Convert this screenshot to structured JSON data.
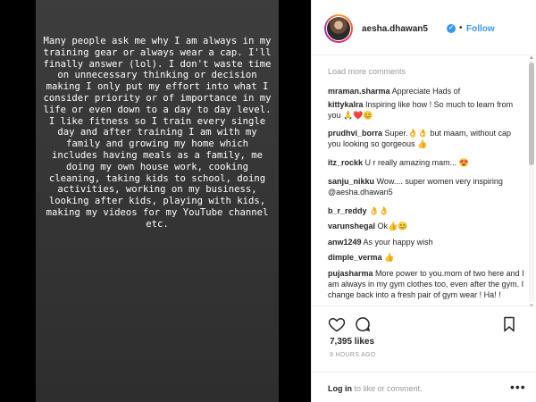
{
  "story": {
    "text": "Many people ask me why I am always in my training gear or always wear a cap.  I'll finally answer (lol).  I don't waste time on unnecessary thinking or decision making I only put my effort into what I consider priority or of importance in my life or even down to a day to day level.  I like fitness so I train every single day and after training I am with my family and growing my home which includes having meals as a family, me doing my own house work, cooking cleaning, taking kids to school, doing activities, working on my business, looking after kids, playing with kids, making my videos for my YouTube channel etc."
  },
  "header": {
    "username": "aesha.dhawan5",
    "verified_mark": "✓",
    "separator": "•",
    "follow_label": "Follow"
  },
  "comments": {
    "load_more": "Load more comments",
    "items": [
      {
        "user": "mraman.sharma",
        "text": "Appreciate Hads of"
      },
      {
        "user": "kittykalra",
        "text": "Inspiring like how ! So much to learn from you 🙏❤️😊"
      },
      {
        "user": "prudhvi_borra",
        "text": "Super.👌👌 but maam, without cap you looking so gorgeous 👍"
      },
      {
        "user": "itz_rockk",
        "text": "U r really amazing mam... 😍"
      },
      {
        "user": "sanju_nikku",
        "text": "Wow.... super women very inspiring @aesha.dhawan5"
      },
      {
        "user": "b_r_reddy",
        "text": "👌👌"
      },
      {
        "user": "varunshegal",
        "text": "Ok👍😊"
      },
      {
        "user": "anw1249",
        "text": "As your happy wish"
      },
      {
        "user": "dimple_verma",
        "text": "👍"
      },
      {
        "user": "pujasharma",
        "text": "More power to you.mom of two here and I am always in my gym clothes too, even after the gym. I change back into a fresh pair of gym wear ! Ha! !"
      }
    ]
  },
  "stats": {
    "likes": "7,395 likes",
    "time": "9 HOURS AGO"
  },
  "footer": {
    "login": "Log in",
    "rest": " to like or comment.",
    "more": "•••"
  },
  "icons": {
    "heart": "heart-icon",
    "comment": "comment-icon",
    "bookmark": "bookmark-icon",
    "verified": "verified-badge-icon"
  }
}
